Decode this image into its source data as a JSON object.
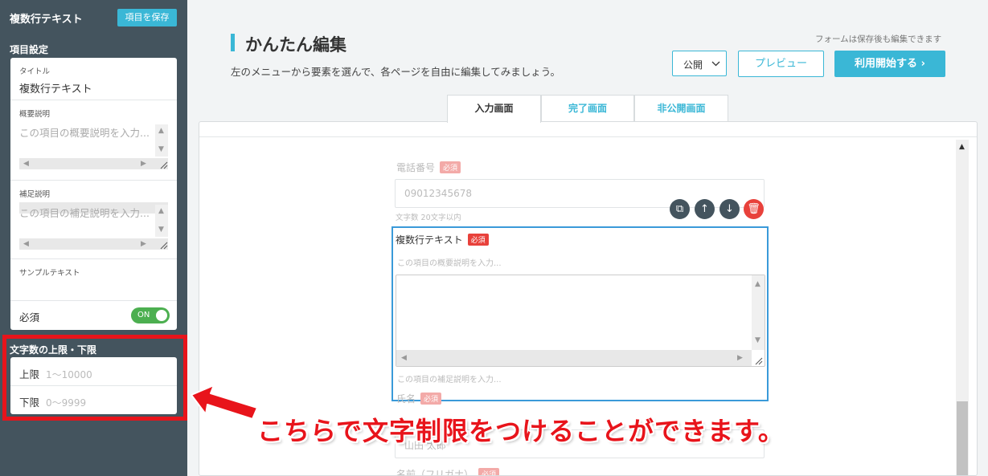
{
  "sidebar": {
    "title": "複数行テキスト",
    "save_label": "項目を保存",
    "section_settings": "項目設定",
    "title_field": {
      "label": "タイトル",
      "value": "複数行テキスト"
    },
    "summary_field": {
      "label": "概要説明",
      "placeholder": "この項目の概要説明を入力..."
    },
    "supplement_field": {
      "label": "補足説明",
      "placeholder": "この項目の補足説明を入力..."
    },
    "sample_field": {
      "label": "サンプルテキスト"
    },
    "required": {
      "label": "必須",
      "toggle": "ON"
    },
    "section_limit": "文字数の上限・下限",
    "upper": {
      "label": "上限",
      "placeholder": "1〜10000"
    },
    "lower": {
      "label": "下限",
      "placeholder": "0〜9999"
    }
  },
  "header": {
    "title": "かんたん編集",
    "subtitle": "左のメニューから要素を選んで、各ページを自由に編集してみましょう。",
    "save_note": "フォームは保存後も編集できます",
    "visibility": "公開",
    "preview": "プレビュー",
    "start": "利用開始する ›"
  },
  "tabs": [
    "入力画面",
    "完了画面",
    "非公開画面"
  ],
  "form": {
    "phone": {
      "label": "電話番号",
      "badge": "必須",
      "placeholder": "09012345678",
      "hint": "文字数 20文字以内"
    },
    "multiline": {
      "label": "複数行テキスト",
      "badge": "必須",
      "summary": "この項目の概要説明を入力...",
      "supplement": "この項目の補足説明を入力..."
    },
    "name": {
      "label": "氏名",
      "badge": "必須",
      "value": "山田 太郎"
    },
    "kana": {
      "label": "名前（フリガナ）",
      "badge": "必須"
    }
  },
  "controls": {
    "copy": "copy-icon",
    "up": "arrow-up-icon",
    "down": "arrow-down-icon",
    "delete": "trash-icon"
  },
  "annotation": "こちらで文字制限をつけることができます。",
  "colors": {
    "sidebar": "#44545e",
    "accent": "#3ab7d6",
    "required": "#e8413b",
    "annotation": "#e8141b"
  }
}
